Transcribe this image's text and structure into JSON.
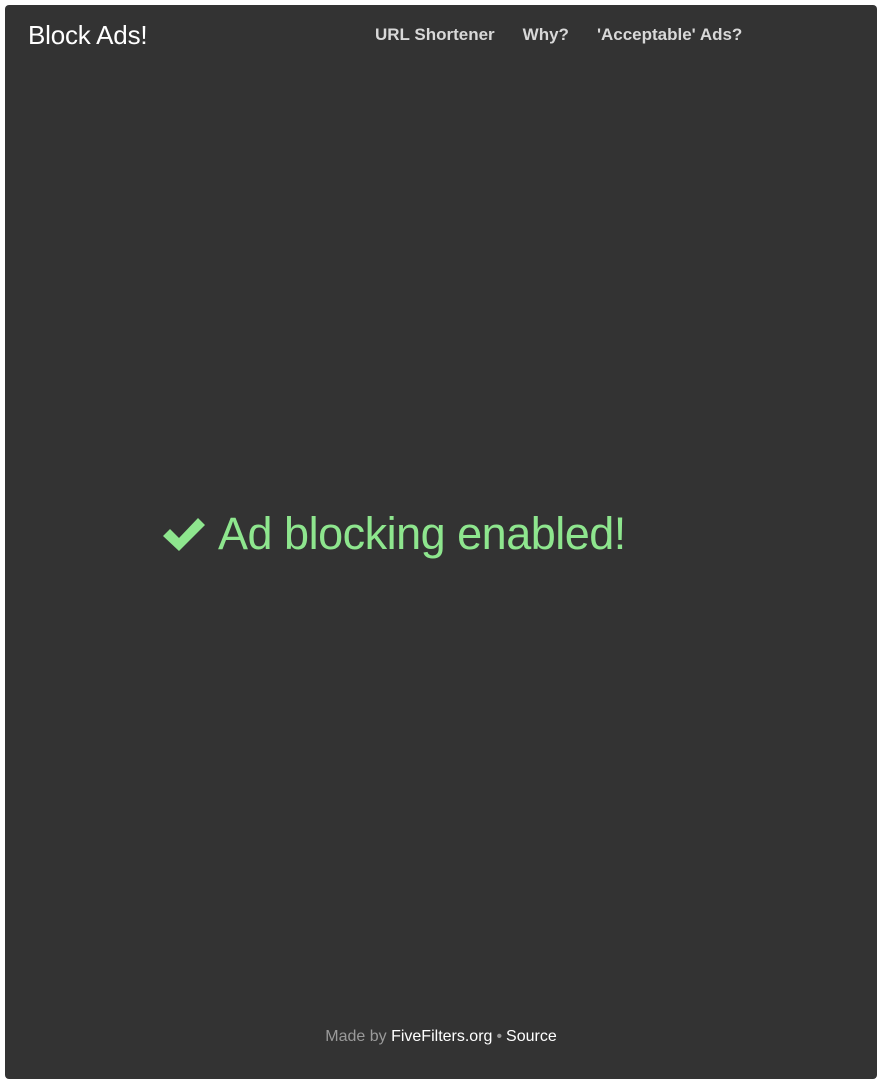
{
  "header": {
    "brand": "Block Ads!",
    "nav": [
      {
        "label": "URL Shortener"
      },
      {
        "label": "Why?"
      },
      {
        "label": "'Acceptable' Ads?"
      }
    ]
  },
  "main": {
    "status_icon": "checkmark-icon",
    "status_message": "Ad blocking enabled!",
    "status_color": "#8ee68e"
  },
  "footer": {
    "made_by_prefix": "Made by",
    "made_by_link": "FiveFilters.org",
    "separator": "•",
    "source_link": "Source"
  },
  "colors": {
    "background": "#333333",
    "nav_text": "#d8d8d8",
    "footer_text": "#9a9a9a"
  }
}
